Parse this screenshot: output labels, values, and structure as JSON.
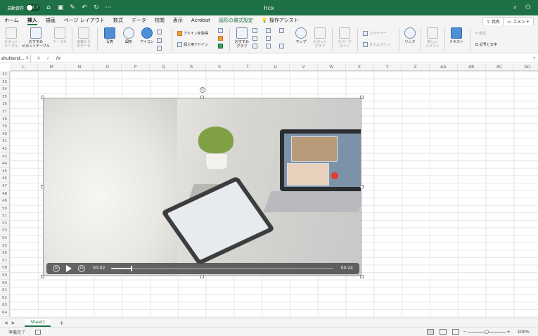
{
  "titlebar": {
    "autosave_label": "自動保存",
    "autosave_state": "オフ",
    "doc_title": "hcx"
  },
  "tabs": [
    {
      "label": "ホーム",
      "active": false
    },
    {
      "label": "挿入",
      "active": true
    },
    {
      "label": "描画",
      "active": false
    },
    {
      "label": "ページ レイアウト",
      "active": false
    },
    {
      "label": "数式",
      "active": false
    },
    {
      "label": "データ",
      "active": false
    },
    {
      "label": "校閲",
      "active": false
    },
    {
      "label": "表示",
      "active": false
    },
    {
      "label": "Acrobat",
      "active": false
    },
    {
      "label": "図形の書式設定",
      "active": false
    }
  ],
  "tell_me": "操作アシスト",
  "share_label": "共有",
  "comment_label": "コメント",
  "ribbon": {
    "pivot_table": "ピボット\nテーブル",
    "recommended_pivot": "おすすめ\nピボットテーブル",
    "table": "テーブル",
    "image_data": "画像から\nのデータ",
    "pictures": "写真",
    "shapes": "図形",
    "icons": "アイコン",
    "get_addins": "アドインを取得",
    "my_addins": "個人用アドイン",
    "recommended_charts": "おすすめ\nグラフ",
    "maps": "マップ",
    "pivot_chart": "ピボット\nグラフ",
    "sparklines": "スパーク\nライン",
    "slicer": "スライサー",
    "timeline": "タイムライン",
    "link": "リンク",
    "new_comment": "新しい\nコメント",
    "text": "テキスト",
    "equation": "数式",
    "symbol": "記号と文字"
  },
  "formula_bar": {
    "name_box": "shutterst...",
    "fx": "fx",
    "value": ""
  },
  "columns": [
    "L",
    "M",
    "N",
    "O",
    "P",
    "Q",
    "R",
    "S",
    "T",
    "U",
    "V",
    "W",
    "X",
    "Y",
    "Z",
    "AA",
    "AB",
    "AC",
    "AD"
  ],
  "rows": [
    "32",
    "33",
    "34",
    "35",
    "36",
    "37",
    "38",
    "39",
    "40",
    "41",
    "42",
    "43",
    "44",
    "45",
    "46",
    "47",
    "48",
    "49",
    "50",
    "51",
    "52",
    "53",
    "54",
    "55",
    "56",
    "57",
    "58",
    "59",
    "60",
    "61",
    "62",
    "63",
    "64"
  ],
  "video": {
    "current_time": "00:02",
    "duration": "00:24",
    "progress": 0.09
  },
  "sheet_tab": "Sheet1",
  "status": {
    "ready": "準備完了",
    "zoom": "100%"
  },
  "colors": {
    "brand": "#1e7145"
  }
}
